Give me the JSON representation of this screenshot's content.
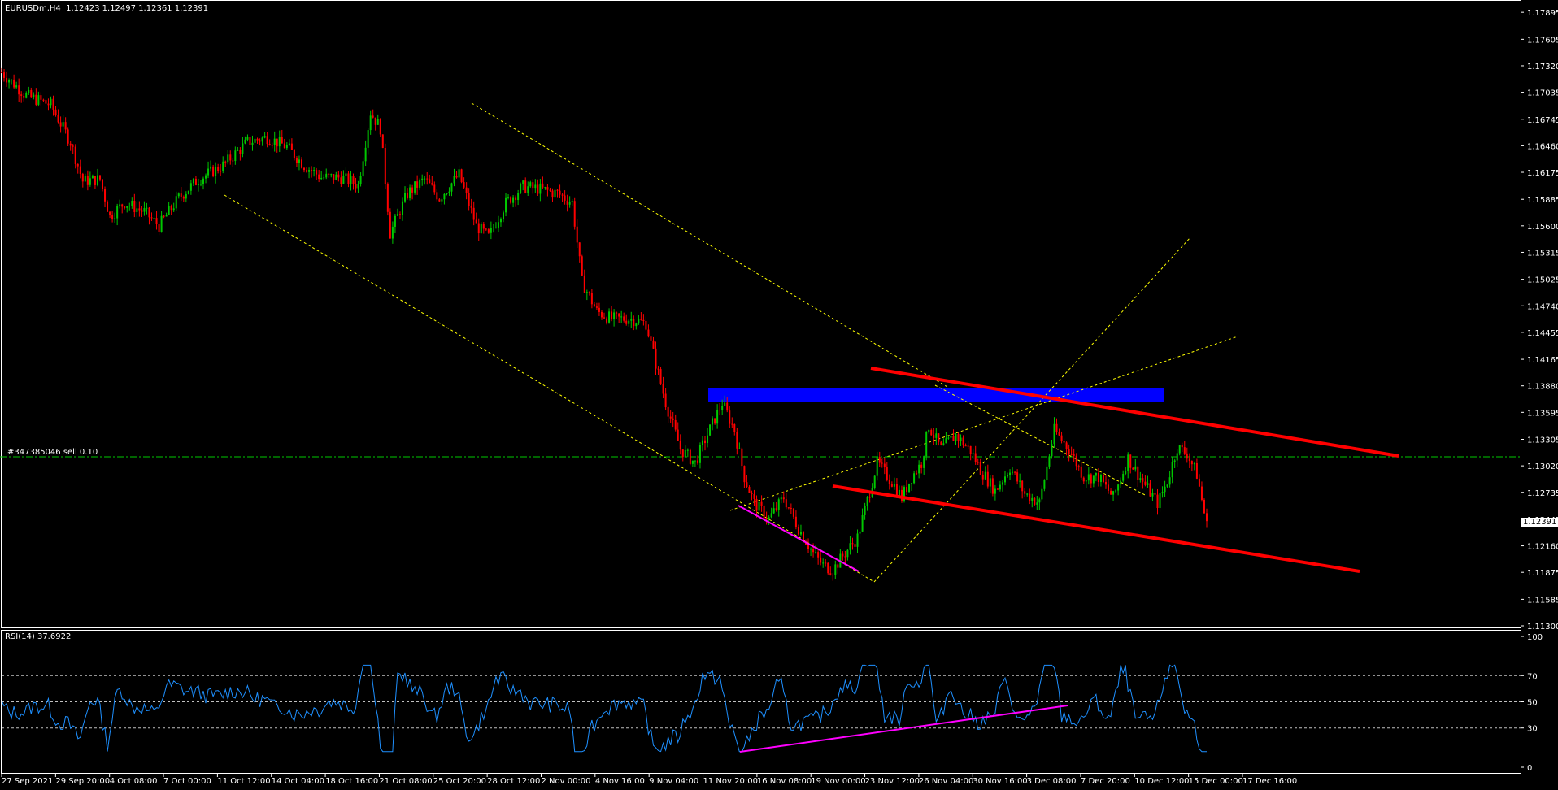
{
  "header": {
    "symbol": "EURUSDm,H4",
    "ohlc": "1.12423 1.12497 1.12361 1.12391"
  },
  "order_label": "#347385046 sell 0.10",
  "current_price_box": "1.12391",
  "price_axis": {
    "ticks": [
      "1.17895",
      "1.17605",
      "1.17320",
      "1.17035",
      "1.16745",
      "1.16460",
      "1.16175",
      "1.15885",
      "1.15600",
      "1.15315",
      "1.15025",
      "1.14740",
      "1.14455",
      "1.14165",
      "1.13880",
      "1.13595",
      "1.13305",
      "1.13020",
      "1.12735",
      "1.12445",
      "1.12160",
      "1.11875",
      "1.11585",
      "1.11300"
    ],
    "range": [
      1.113,
      1.1794
    ]
  },
  "rsi": {
    "label": "RSI(14) 37.6922",
    "ticks": [
      "100",
      "70",
      "50",
      "30",
      "0"
    ],
    "levels": [
      70,
      50,
      30
    ]
  },
  "time_axis": {
    "labels": [
      "27 Sep 2021",
      "29 Sep 20:00",
      "4 Oct 08:00",
      "7 Oct 00:00",
      "11 Oct 12:00",
      "14 Oct 04:00",
      "18 Oct 16:00",
      "21 Oct 08:00",
      "25 Oct 20:00",
      "28 Oct 12:00",
      "2 Nov 00:00",
      "4 Nov 16:00",
      "9 Nov 04:00",
      "11 Nov 20:00",
      "16 Nov 08:00",
      "19 Nov 00:00",
      "23 Nov 12:00",
      "26 Nov 04:00",
      "30 Nov 16:00",
      "3 Dec 08:00",
      "7 Dec 20:00",
      "10 Dec 12:00",
      "15 Dec 00:00",
      "17 Dec 16:00"
    ]
  },
  "colors": {
    "background": "#000000",
    "bull_candle": "#00c800",
    "bear_candle": "#ff0000",
    "grid_line": "#ffffff",
    "rsi_line": "#1e90ff",
    "resistance_zone": "#0000ff",
    "channel_line": "#ff0000",
    "divergence_line": "#ff00ff",
    "dashed_trend": "#ffff00",
    "order_line": "#00c800"
  },
  "chart_data": {
    "type": "candlestick",
    "anchors": [
      [
        0,
        1.1725
      ],
      [
        10,
        1.17
      ],
      [
        20,
        1.169
      ],
      [
        28,
        1.165
      ],
      [
        33,
        1.1608
      ],
      [
        40,
        1.161
      ],
      [
        44,
        1.157
      ],
      [
        50,
        1.1585
      ],
      [
        58,
        1.1575
      ],
      [
        64,
        1.156
      ],
      [
        72,
        1.159
      ],
      [
        80,
        1.161
      ],
      [
        90,
        1.1625
      ],
      [
        100,
        1.165
      ],
      [
        108,
        1.1655
      ],
      [
        116,
        1.1645
      ],
      [
        123,
        1.1625
      ],
      [
        130,
        1.1612
      ],
      [
        138,
        1.1612
      ],
      [
        145,
        1.1604
      ],
      [
        150,
        1.1682
      ],
      [
        154,
        1.1665
      ],
      [
        158,
        1.1552
      ],
      [
        165,
        1.1595
      ],
      [
        172,
        1.161
      ],
      [
        178,
        1.159
      ],
      [
        186,
        1.1615
      ],
      [
        193,
        1.156
      ],
      [
        198,
        1.1548
      ],
      [
        205,
        1.1585
      ],
      [
        212,
        1.1602
      ],
      [
        218,
        1.16
      ],
      [
        226,
        1.1595
      ],
      [
        232,
        1.1585
      ],
      [
        236,
        1.15
      ],
      [
        242,
        1.1468
      ],
      [
        248,
        1.146
      ],
      [
        256,
        1.146
      ],
      [
        262,
        1.1455
      ],
      [
        266,
        1.1412
      ],
      [
        270,
        1.137
      ],
      [
        276,
        1.132
      ],
      [
        282,
        1.1305
      ],
      [
        286,
        1.133
      ],
      [
        293,
        1.137
      ],
      [
        298,
        1.134
      ],
      [
        302,
        1.129
      ],
      [
        306,
        1.1262
      ],
      [
        312,
        1.1245
      ],
      [
        318,
        1.1268
      ],
      [
        324,
        1.1235
      ],
      [
        330,
        1.1208
      ],
      [
        334,
        1.1195
      ],
      [
        338,
        1.119
      ],
      [
        342,
        1.1205
      ],
      [
        348,
        1.1225
      ],
      [
        352,
        1.1265
      ],
      [
        356,
        1.1305
      ],
      [
        362,
        1.1285
      ],
      [
        366,
        1.1268
      ],
      [
        370,
        1.129
      ],
      [
        374,
        1.1305
      ],
      [
        377,
        1.1345
      ],
      [
        382,
        1.132
      ],
      [
        388,
        1.1335
      ],
      [
        394,
        1.1318
      ],
      [
        398,
        1.1298
      ],
      [
        404,
        1.1275
      ],
      [
        410,
        1.13
      ],
      [
        416,
        1.1272
      ],
      [
        422,
        1.1262
      ],
      [
        428,
        1.134
      ],
      [
        434,
        1.132
      ],
      [
        440,
        1.129
      ],
      [
        446,
        1.129
      ],
      [
        452,
        1.1268
      ],
      [
        458,
        1.131
      ],
      [
        464,
        1.1285
      ],
      [
        470,
        1.1262
      ],
      [
        474,
        1.1285
      ],
      [
        478,
        1.1322
      ],
      [
        482,
        1.1315
      ],
      [
        486,
        1.1293
      ],
      [
        490,
        1.1238
      ]
    ],
    "x_range": [
      0,
      500
    ]
  }
}
